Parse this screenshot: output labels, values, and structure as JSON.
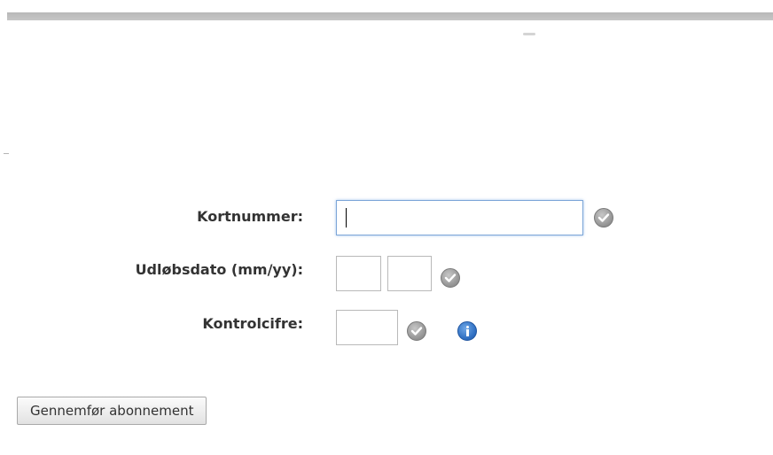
{
  "form": {
    "card_number": {
      "label": "Kortnummer:",
      "value": ""
    },
    "expiry": {
      "label": "Udløbsdato (mm/yy):",
      "month_value": "",
      "year_value": ""
    },
    "cvc": {
      "label": "Kontrolcifre:",
      "value": ""
    },
    "submit_label": "Gennemfør abonnement"
  },
  "icons": {
    "validation": "check-circle-icon",
    "info": "info-icon"
  },
  "colors": {
    "focus_border": "#7da6d8",
    "info_blue": "#2f6fc2",
    "check_grey": "#9a9a9a"
  }
}
